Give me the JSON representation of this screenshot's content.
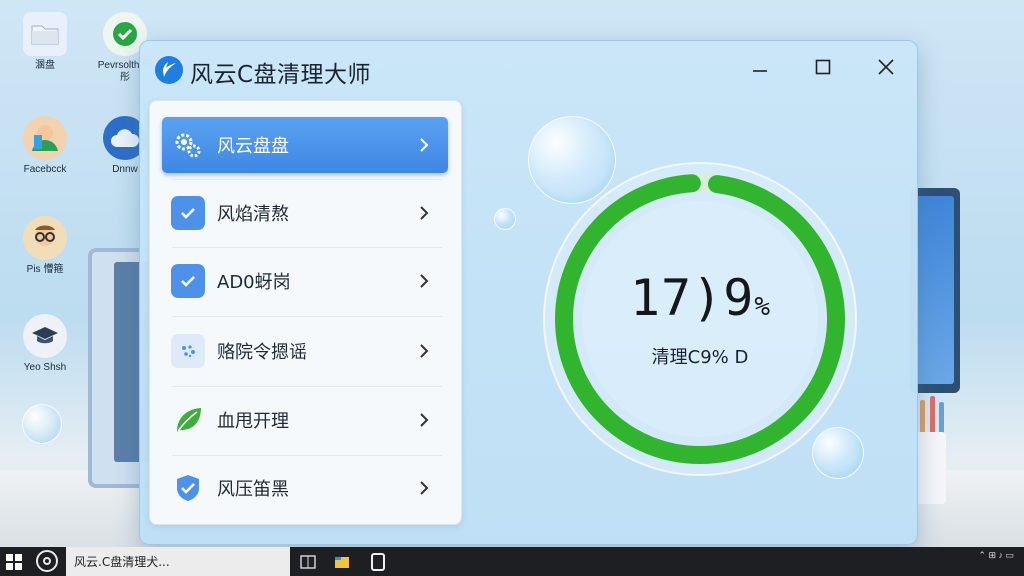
{
  "desktop": {
    "icons": [
      {
        "label": "溷盘"
      },
      {
        "label": "Pevrsolth 斟彤"
      },
      {
        "label": "Facebcck"
      },
      {
        "label": "Dnnw"
      },
      {
        "label": "Pis 懵箍"
      },
      {
        "label": "Yeo Shsh"
      }
    ]
  },
  "window": {
    "title": "风云C盘清理大师",
    "menu": [
      {
        "label": "风云盘盘",
        "icon": "gear-cluster-icon",
        "active": true
      },
      {
        "label": "风焰清熬",
        "icon": "check-shield-icon",
        "active": false
      },
      {
        "label": "AD0蚜岗",
        "icon": "check-shield-icon",
        "active": false
      },
      {
        "label": "赂院令摁谣",
        "icon": "dots-cluster-icon",
        "active": false
      },
      {
        "label": "血甩开理",
        "icon": "leaf-icon",
        "active": false
      },
      {
        "label": "风压笛黑",
        "icon": "check-shield-icon",
        "active": false
      }
    ],
    "gauge": {
      "value_text": "17)9",
      "unit": "%",
      "subtitle": "清理C9% D",
      "progress": 0.97
    }
  },
  "taskbar": {
    "task_label": "风云.C盘清理犬..."
  },
  "colors": {
    "accent": "#3f86e3",
    "gauge_green": "#31b52f",
    "gauge_track": "#d9f0dc"
  }
}
